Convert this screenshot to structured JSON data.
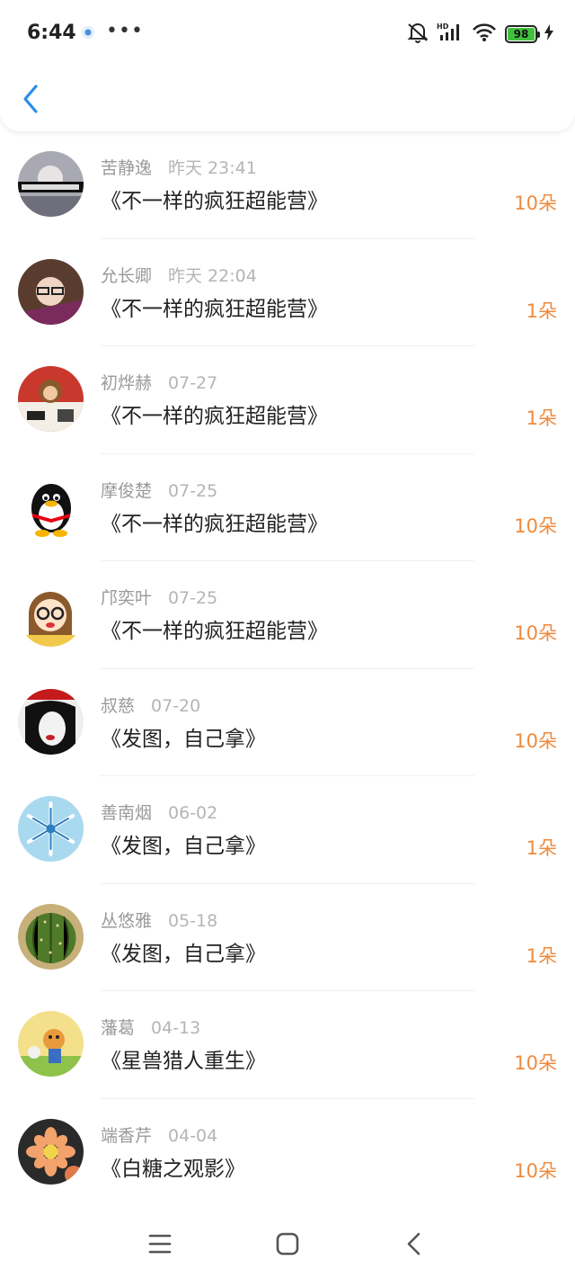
{
  "status_bar": {
    "time": "6:44",
    "more": "•••",
    "battery": "98",
    "network": "HD"
  },
  "header": {
    "back_icon": "chevron-left-icon"
  },
  "colors": {
    "accent": "#2b8ee8",
    "amount": "#f08a3c",
    "battery_green": "#41c23d"
  },
  "records": [
    {
      "name": "苦静逸",
      "date": "昨天 23:41",
      "title": "《不一样的疯狂超能营》",
      "amount": "10朵"
    },
    {
      "name": "允长卿",
      "date": "昨天 22:04",
      "title": "《不一样的疯狂超能营》",
      "amount": "1朵"
    },
    {
      "name": "初烨赫",
      "date": "07-27",
      "title": "《不一样的疯狂超能营》",
      "amount": "1朵"
    },
    {
      "name": "摩俊楚",
      "date": "07-25",
      "title": "《不一样的疯狂超能营》",
      "amount": "10朵"
    },
    {
      "name": "邝奕叶",
      "date": "07-25",
      "title": "《不一样的疯狂超能营》",
      "amount": "10朵"
    },
    {
      "name": "叔慈",
      "date": "07-20",
      "title": "《发图，自己拿》",
      "amount": "10朵"
    },
    {
      "name": "善南烟",
      "date": "06-02",
      "title": "《发图，自己拿》",
      "amount": "1朵"
    },
    {
      "name": "丛悠雅",
      "date": "05-18",
      "title": "《发图，自己拿》",
      "amount": "1朵"
    },
    {
      "name": "藩葛",
      "date": "04-13",
      "title": "《星兽猎人重生》",
      "amount": "10朵"
    },
    {
      "name": "端香芹",
      "date": "04-04",
      "title": "《白糖之观影》",
      "amount": "10朵"
    }
  ],
  "nav": {
    "menu": "menu-icon",
    "home": "home-icon",
    "back": "back-icon"
  }
}
